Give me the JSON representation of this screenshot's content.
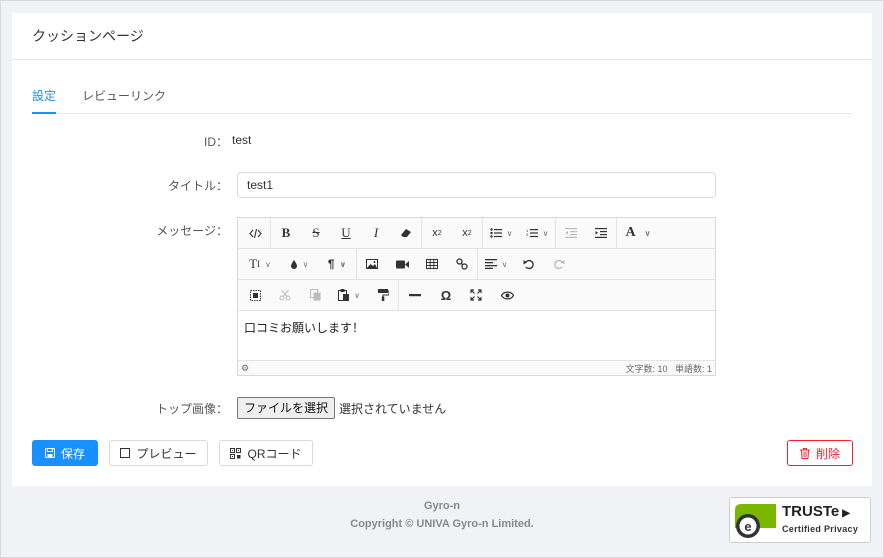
{
  "page": {
    "title": "クッションページ"
  },
  "tabs": [
    {
      "label": "設定"
    },
    {
      "label": "レビューリンク"
    }
  ],
  "form": {
    "id_label": "ID：",
    "id_value": "test",
    "title_label": "タイトル：",
    "title_value": "test1",
    "message_label": "メッセージ：",
    "editor_content": "口コミお願いします！",
    "char_count": "文字数: 10",
    "word_count": "単語数: 1",
    "image_label": "トップ画像：",
    "file_button": "ファイルを選択",
    "file_status": "選択されていません"
  },
  "toolbar": {
    "row1": [
      "code-view",
      "bold",
      "strikethrough",
      "underline",
      "italic",
      "eraser",
      "superscript",
      "subscript",
      "unordered-list",
      "ordered-list",
      "outdent",
      "indent",
      "font-color"
    ],
    "row2": [
      "font-size",
      "color-fill",
      "paragraph",
      "image",
      "video",
      "table",
      "link",
      "align",
      "undo",
      "redo"
    ],
    "row3": [
      "select-all",
      "cut",
      "copy",
      "paste",
      "format-painter",
      "horizontal-rule",
      "special-char",
      "fullscreen",
      "preview"
    ]
  },
  "buttons": {
    "save": "保存",
    "preview": "プレビュー",
    "qr": "QRコード",
    "delete": "削除"
  },
  "footer": {
    "brand": "Gyro-n",
    "copyright": "Copyright © UNIVA Gyro-n Limited."
  },
  "badge": {
    "name": "TRUSTe",
    "sub": "Certified Privacy"
  },
  "colors": {
    "primary": "#1890ff",
    "danger": "#f5222d",
    "truste_green": "#7ab800"
  }
}
